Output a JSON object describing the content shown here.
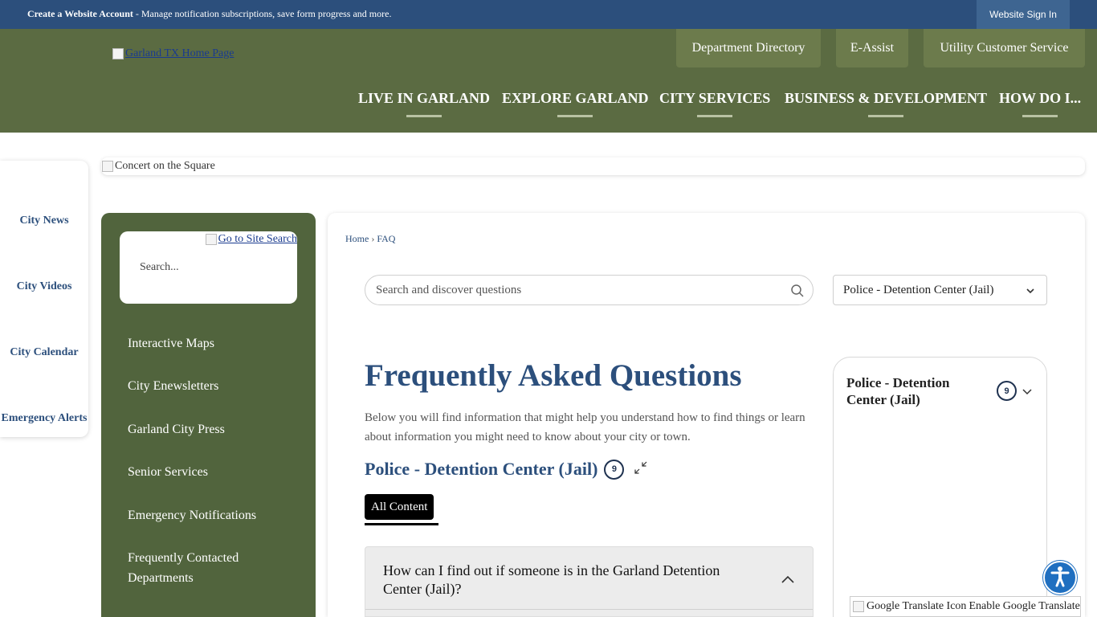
{
  "topbar": {
    "create_account": "Create a Website Account",
    "create_account_desc": " - Manage notification subscriptions, save form progress and more.",
    "sign_in": "Website Sign In"
  },
  "header": {
    "logo_alt": "Garland TX Home Page",
    "quick_buttons": [
      "Department Directory",
      "E-Assist",
      "Utility Customer Service"
    ],
    "nav": [
      "LIVE IN GARLAND",
      "EXPLORE GARLAND",
      "CITY SERVICES",
      "BUSINESS & DEVELOPMENT",
      "HOW DO I..."
    ]
  },
  "quicklinks": [
    "City News",
    "City Videos",
    "City Calendar",
    "Emergency Alerts"
  ],
  "banner": {
    "alt": "Concert on the Square"
  },
  "sidebar": {
    "search_link": "Go to Site Search",
    "search_placeholder": "Search...",
    "links": [
      "Interactive Maps",
      "City Enewsletters",
      "Garland City Press",
      "Senior Services",
      "Emergency Notifications",
      "Frequently Contacted Departments"
    ]
  },
  "breadcrumb": {
    "home": "Home",
    "separator": "›",
    "current": "FAQ"
  },
  "faq": {
    "search_placeholder": "Search and discover questions",
    "category_select": "Police - Detention Center (Jail)",
    "title": "Frequently Asked Questions",
    "intro": "Below you will find information that might help you understand how to find things or learn about information you might need to know about your city or town.",
    "category_heading": "Police - Detention Center (Jail)",
    "category_count": "9",
    "tab_all": "All Content",
    "questions": [
      "How can I find out if someone is in the Garland Detention Center (Jail)?"
    ]
  },
  "category_card": {
    "name": "Police - Detention Center (Jail)",
    "count": "9"
  },
  "translate": {
    "icon_alt": "Google Translate Icon",
    "label": "Enable Google Translate"
  },
  "colors": {
    "topbar": "#2c4f7c",
    "header": "#5b6b42",
    "sidebar": "#51643d",
    "heading": "#2c4f7c",
    "accessibility": "#1f6fc0"
  }
}
